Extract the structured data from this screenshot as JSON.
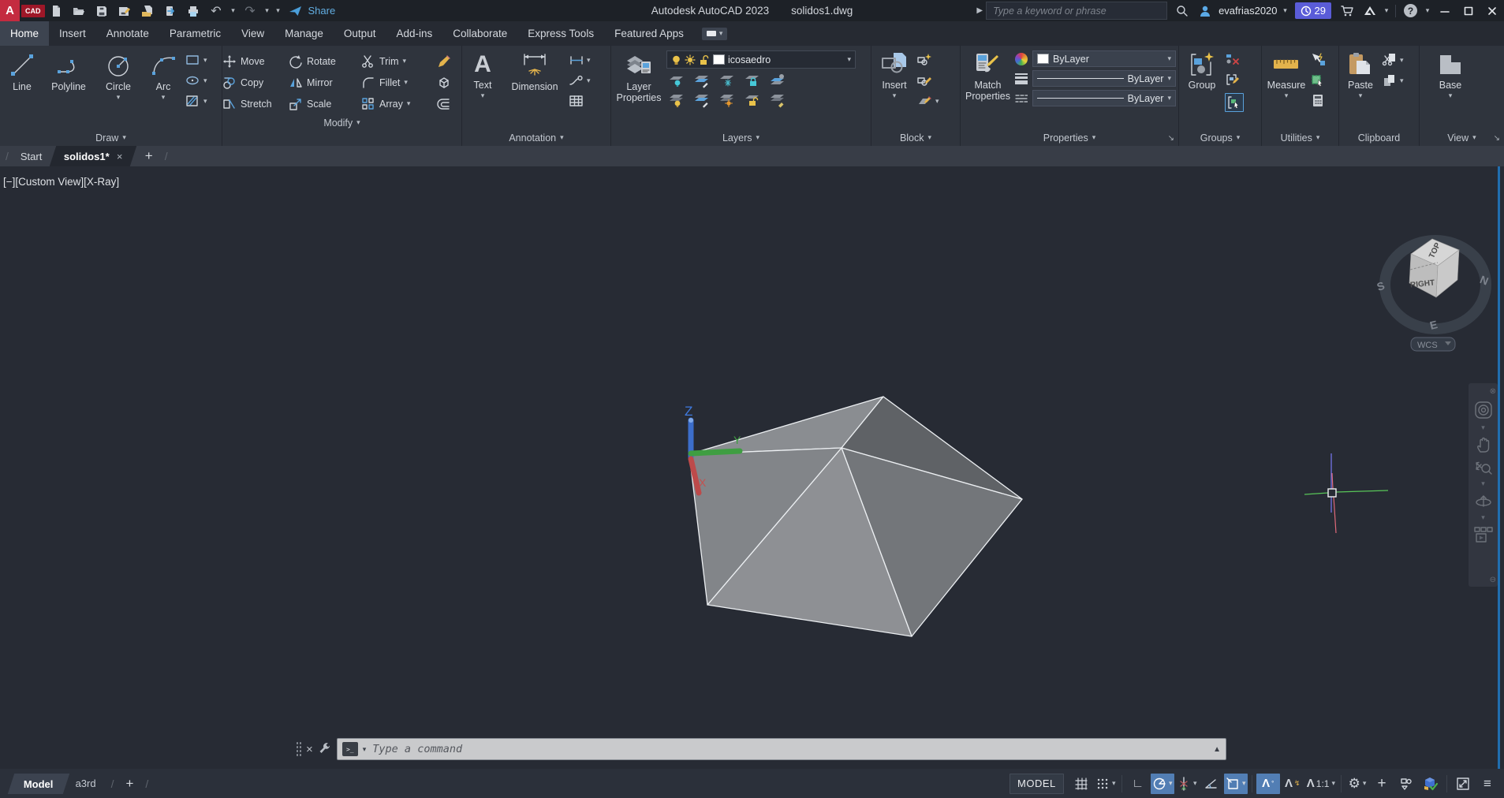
{
  "titlebar": {
    "logo_a": "A",
    "logo_cad": "CAD",
    "share_label": "Share",
    "app_title": "Autodesk AutoCAD 2023",
    "doc_title": "solidos1.dwg",
    "search_placeholder": "Type a keyword or phrase",
    "username": "evafrias2020",
    "license_days": "29"
  },
  "icons": {
    "dropdown": "▾",
    "up_arrow": "▲",
    "undo": "↶",
    "redo": "↷",
    "close": "×",
    "slash": "/",
    "play_small": "▶",
    "ortho": "∟",
    "angle": "∠",
    "menu": "≡",
    "gear": "⚙",
    "plus": "+",
    "help": "?",
    "lambda": "Λ",
    "lightning": "↯",
    "degree": "°",
    "prompt": ">_",
    "snap_dots": "∷",
    "launcher": "↘",
    "minus_circle": "⊖",
    "x_circle": "⊗"
  },
  "ribbon_tabs": [
    {
      "label": "Home",
      "active": true
    },
    {
      "label": "Insert"
    },
    {
      "label": "Annotate"
    },
    {
      "label": "Parametric"
    },
    {
      "label": "View"
    },
    {
      "label": "Manage"
    },
    {
      "label": "Output"
    },
    {
      "label": "Add-ins"
    },
    {
      "label": "Collaborate"
    },
    {
      "label": "Express Tools"
    },
    {
      "label": "Featured Apps"
    }
  ],
  "panels": {
    "draw": {
      "label": "Draw",
      "tools": {
        "line": "Line",
        "polyline": "Polyline",
        "circle": "Circle",
        "arc": "Arc"
      }
    },
    "modify": {
      "label": "Modify",
      "tools": {
        "move": "Move",
        "rotate": "Rotate",
        "trim": "Trim",
        "copy": "Copy",
        "mirror": "Mirror",
        "fillet": "Fillet",
        "stretch": "Stretch",
        "scale": "Scale",
        "array": "Array"
      }
    },
    "annotation": {
      "label": "Annotation",
      "tools": {
        "text": "Text",
        "dimension": "Dimension"
      }
    },
    "layers": {
      "label": "Layers",
      "layer_properties": "Layer Properties",
      "current_layer": "icosaedro"
    },
    "block": {
      "label": "Block",
      "insert": "Insert"
    },
    "properties": {
      "label": "Properties",
      "match_properties": "Match Properties",
      "object_color": "ByLayer",
      "lineweight": "ByLayer",
      "linetype": "ByLayer"
    },
    "groups": {
      "label": "Groups",
      "group": "Group"
    },
    "utilities": {
      "label": "Utilities",
      "measure": "Measure"
    },
    "clipboard": {
      "label": "Clipboard",
      "paste": "Paste"
    },
    "view": {
      "label": "View",
      "base": "Base"
    }
  },
  "file_tabs": {
    "start": "Start",
    "drawing": "solidos1*",
    "new_tab": "+"
  },
  "viewport": {
    "controls": {
      "minimize": "[−]",
      "view_name": "[Custom View]",
      "visual_style": "[X-Ray]"
    },
    "viewcube": {
      "top_face": "TOP",
      "front_face": "RIGHT",
      "compass_s": "S",
      "compass_n": "N",
      "compass_e": "E",
      "wcs": "WCS"
    },
    "ucs": {
      "x": "X",
      "y": "Y",
      "z": "Z"
    }
  },
  "command_line": {
    "placeholder": "Type a command"
  },
  "status_bar": {
    "model_tab": "Model",
    "layout_tab": "a3rd",
    "new_layout": "+",
    "model_space": "MODEL",
    "annotation_scale": "1:1"
  },
  "colors": {
    "accent_blue": "#5aa2dc",
    "tool_yellow": "#e3b34c",
    "active_highlight": "#527eb4",
    "license_badge": "#5a5cd8",
    "axis_x_red": "#bd4a4a",
    "axis_y_green": "#3f9e42",
    "axis_z_blue": "#3c6ecb",
    "crosshair_green": "#58c558",
    "crosshair_blue": "#7a7af5",
    "crosshair_red": "#e06a7a",
    "solid_face_top_left": "#8a8d91",
    "solid_face_top_right": "#5f6266",
    "solid_face_right": "#73767a",
    "solid_face_bottom": "#8e9094",
    "solid_face_left": "#828589"
  }
}
